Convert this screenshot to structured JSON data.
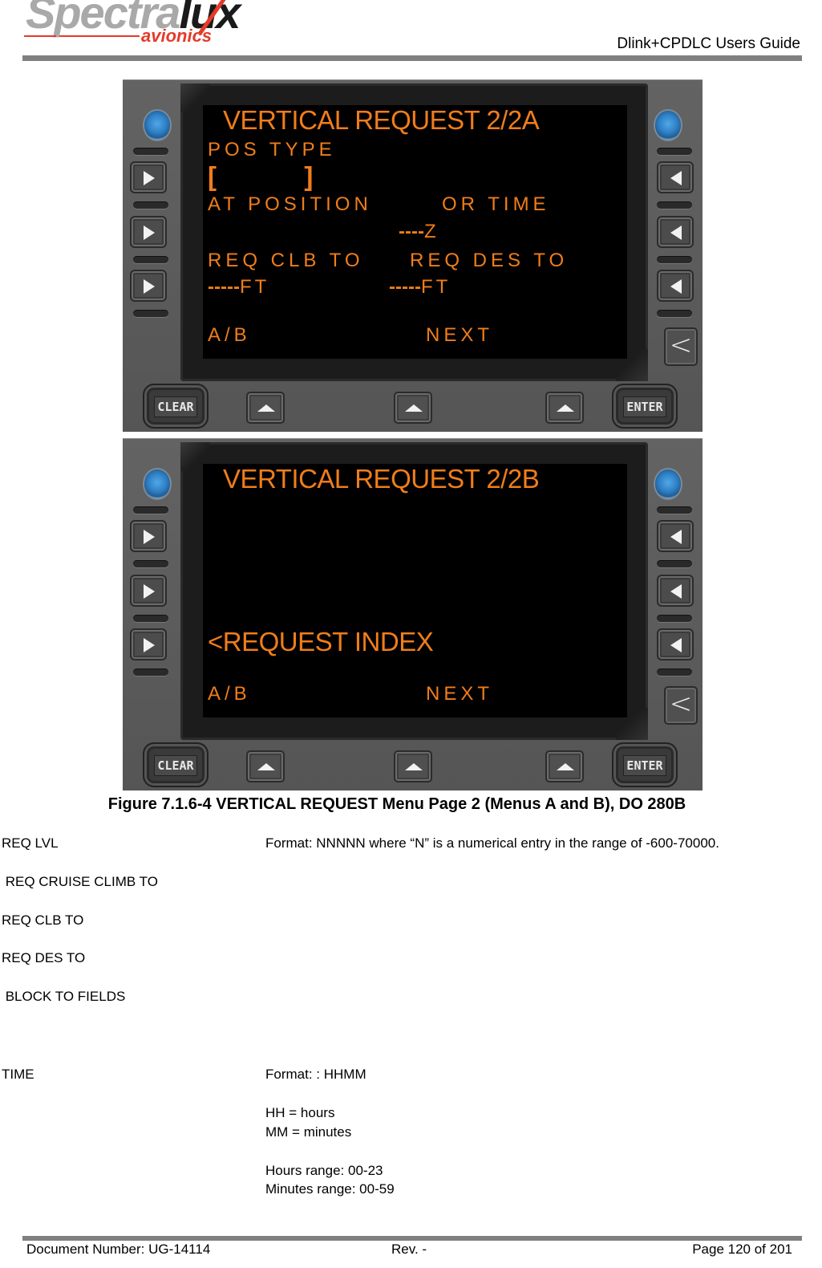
{
  "header": {
    "logo": {
      "brand_gray": "Spectra",
      "brand_dark": "lux",
      "subtitle": "avionics",
      "accent": "#e53a2a"
    },
    "title": "Dlink+CPDLC Users Guide"
  },
  "screen_color": "#f07d1a",
  "panels": [
    {
      "id": "A",
      "lines": {
        "title": "VERTICAL REQUEST 2/2A",
        "l1": "POS TYPE",
        "l2": "[        ]",
        "l3_left": "AT POSITION",
        "l3_right": "OR TIME",
        "l4_dash": "----",
        "l4_suffix": "Z",
        "l5_left": "REQ CLB TO",
        "l5_right": "REQ DES TO",
        "l6_left_dash": "-----",
        "l6_left_suffix": "FT",
        "l6_right_dash": "-----",
        "l6_right_suffix": "FT",
        "bottom_left": "A/B",
        "bottom_right": "NEXT"
      }
    },
    {
      "id": "B",
      "lines": {
        "title": "VERTICAL REQUEST 2/2B",
        "l5_left": "<REQUEST INDEX",
        "bottom_left": "A/B",
        "bottom_right": "NEXT"
      }
    }
  ],
  "keys": {
    "clear": "CLEAR",
    "enter": "ENTER",
    "back": "<"
  },
  "caption": "Figure 7.1.6-4 VERTICAL REQUEST Menu Page 2 (Menus A and B), DO 280B",
  "fields": [
    {
      "label": "REQ LVL",
      "desc": "Format: NNNNN where “N” is a numerical entry in the range of -600-70000."
    },
    {
      "label": " REQ CRUISE CLIMB TO"
    },
    {
      "label": "REQ CLB TO"
    },
    {
      "label": "REQ DES TO"
    },
    {
      "label": " BLOCK TO FIELDS"
    }
  ],
  "time_field": {
    "label": "TIME",
    "format": "Format: : HHMM",
    "hh": "HH = hours",
    "mm": "MM = minutes",
    "hours_range": "Hours range: 00-23",
    "minutes_range": "Minutes range: 00-59"
  },
  "footer": {
    "doc_number": "Document Number:  UG-14114",
    "rev": "Rev. -",
    "page": "Page 120 of 201"
  }
}
